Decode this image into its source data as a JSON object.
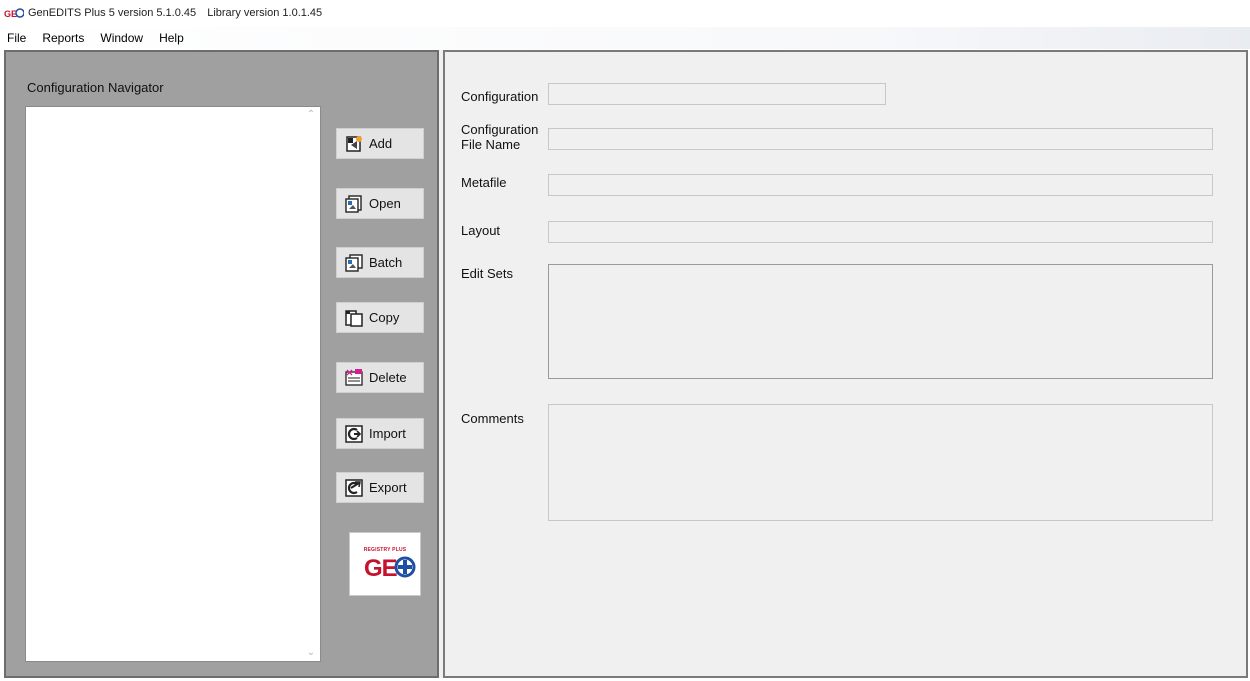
{
  "window": {
    "title_app": "GenEDITS Plus 5 version 5.1.0.45",
    "title_lib": "Library version 1.0.1.45"
  },
  "menu": {
    "items": [
      "File",
      "Reports",
      "Window",
      "Help"
    ]
  },
  "navigator": {
    "title": "Configuration Navigator",
    "buttons": [
      {
        "label": "Add",
        "icon": "add-icon"
      },
      {
        "label": "Open",
        "icon": "open-icon"
      },
      {
        "label": "Batch",
        "icon": "batch-icon"
      },
      {
        "label": "Copy",
        "icon": "copy-icon"
      },
      {
        "label": "Delete",
        "icon": "delete-icon"
      },
      {
        "label": "Import",
        "icon": "import-icon"
      },
      {
        "label": "Export",
        "icon": "export-icon"
      }
    ],
    "logo": {
      "small_text": "REGISTRY PLUS",
      "big_text": "GE"
    }
  },
  "details": {
    "configuration": {
      "label": "Configuration",
      "value": ""
    },
    "config_file_name": {
      "label_line1": "Configuration",
      "label_line2": "File Name",
      "value": ""
    },
    "metafile": {
      "label": "Metafile",
      "value": ""
    },
    "layout": {
      "label": "Layout",
      "value": ""
    },
    "edit_sets": {
      "label": "Edit Sets"
    },
    "comments": {
      "label": "Comments"
    }
  },
  "colors": {
    "left_panel": "#a0a0a0",
    "right_panel": "#f0f0f0",
    "logo_red": "#c4122f",
    "logo_blue": "#1f4fa3"
  }
}
